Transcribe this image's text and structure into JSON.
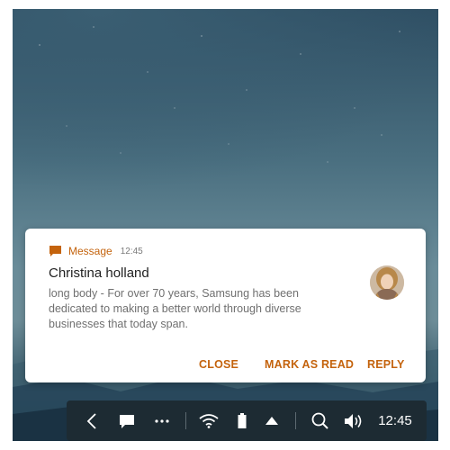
{
  "notification": {
    "app_name": "Message",
    "time": "12:45",
    "sender": "Christina holland",
    "body": "long body - For over 70 years, Samsung has been dedicated to making a better world through diverse businesses that today span.",
    "actions": {
      "close": "CLOSE",
      "mark_as_read": "MARK AS READ",
      "reply": "REPLY"
    }
  },
  "taskbar": {
    "icons": [
      "back-icon",
      "message-icon",
      "more-icon",
      "wifi-icon",
      "battery-icon",
      "expand-up-icon",
      "search-icon",
      "volume-icon"
    ],
    "clock": "12:45"
  },
  "colors": {
    "accent": "#c4630d",
    "taskbar_bg": "#1d2b33"
  }
}
